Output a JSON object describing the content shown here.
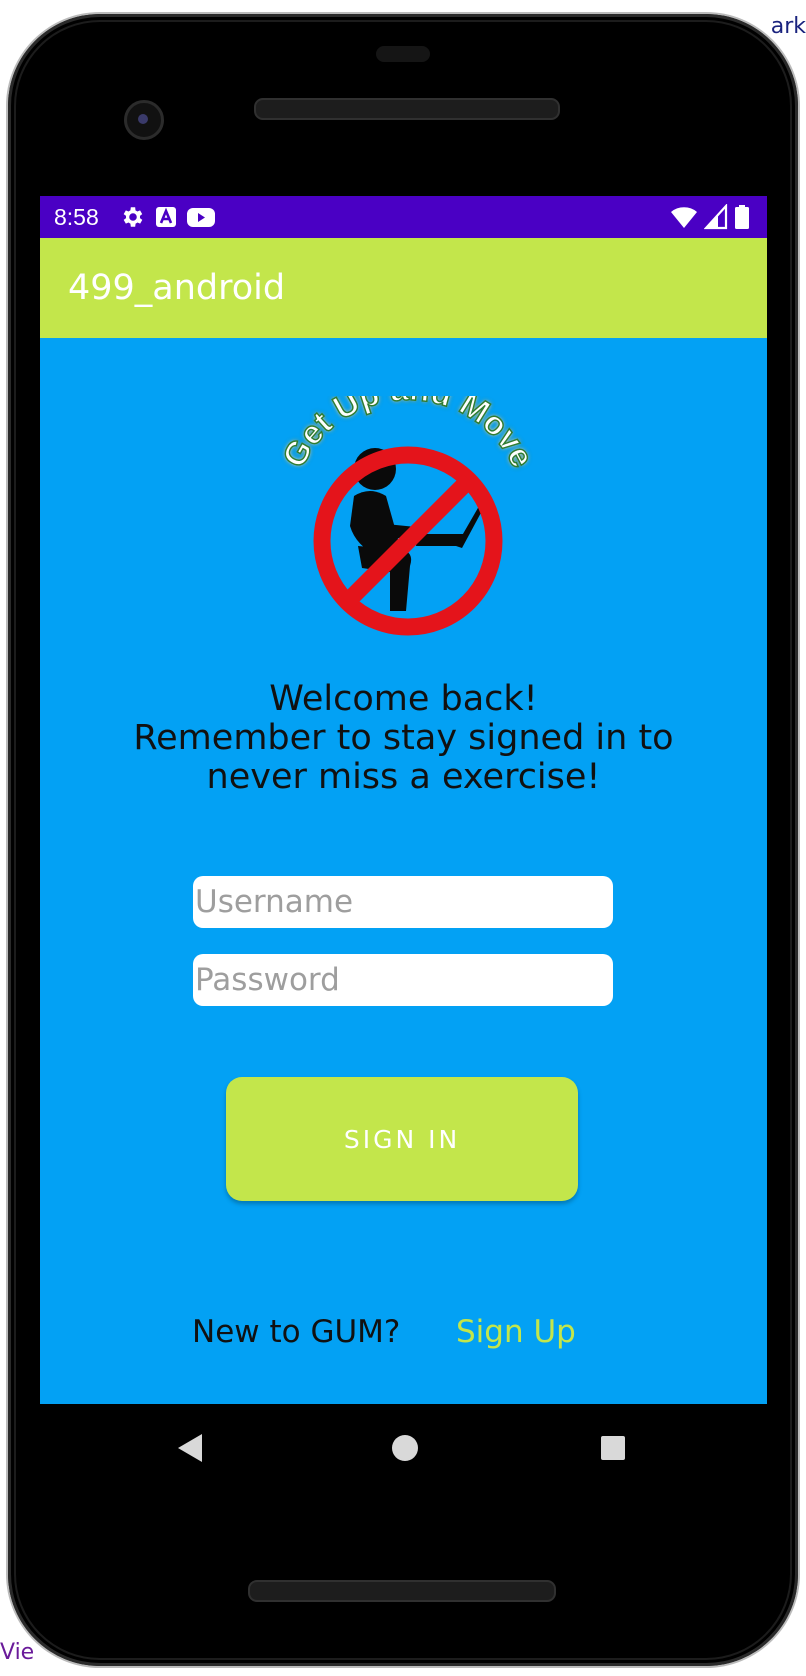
{
  "background": {
    "right_top_text": "ark",
    "left_bottom_text": "Vie"
  },
  "status_bar": {
    "time": "8:58",
    "icons": [
      "gear-icon",
      "a-box-icon",
      "youtube-icon",
      "wifi-icon",
      "signal-icon",
      "battery-icon"
    ],
    "color": "#4a00c4"
  },
  "app_bar": {
    "title": "499_android",
    "color": "#c3e64b"
  },
  "logo": {
    "text": "Get Up and Move"
  },
  "welcome": {
    "line1": "Welcome back!",
    "line2": "Remember to stay signed in to",
    "line3": "never miss a exercise!"
  },
  "form": {
    "username_placeholder": "Username",
    "password_placeholder": "Password",
    "sign_in_label": "SIGN IN"
  },
  "footer": {
    "prompt": "New to GUM?",
    "sign_up_label": "Sign Up",
    "link_color": "#c3e64b"
  },
  "nav_bar": {
    "icons": [
      "back-icon",
      "home-icon",
      "recents-icon"
    ]
  },
  "colors": {
    "screen_background": "#03a1f4",
    "accent": "#c3e64b",
    "status_bar": "#4a00c4"
  }
}
